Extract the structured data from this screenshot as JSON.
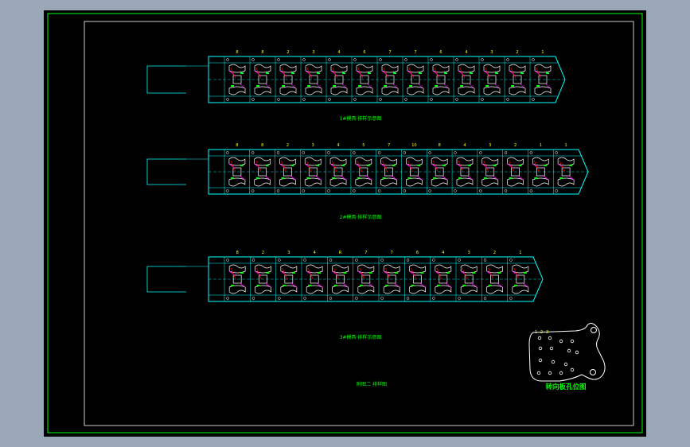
{
  "colors": {
    "background": "#9aa7b6",
    "canvas": "#000000",
    "frame": "#00ff00",
    "outline": "#00ffff",
    "fixture": "#ffffff",
    "accent": "#ff00ff",
    "link": "#ff0000",
    "label": "#00ff00",
    "number": "#ffff00"
  },
  "strips": [
    {
      "caption": "1#模具·排样示意图",
      "stations": [
        "8",
        "8",
        "2",
        "3",
        "4",
        "6",
        "7",
        "7",
        "6",
        "4",
        "3",
        "2",
        "1"
      ]
    },
    {
      "caption": "2#模具·排样示意图",
      "stations": [
        "8",
        "8",
        "2",
        "3",
        "4",
        "5",
        "7",
        "10",
        "8",
        "4",
        "3",
        "2",
        "1",
        "1"
      ]
    },
    {
      "caption": "3#模具·排样示意图",
      "stations": [
        "8",
        "2",
        "3",
        "4",
        "R",
        "7",
        "7",
        "6",
        "4",
        "3",
        "2",
        "1"
      ]
    }
  ],
  "title_block": {
    "caption": "附图二 排样图"
  },
  "detail": {
    "caption": "转向板孔位图",
    "markers": [
      "1",
      "2",
      "3"
    ]
  }
}
